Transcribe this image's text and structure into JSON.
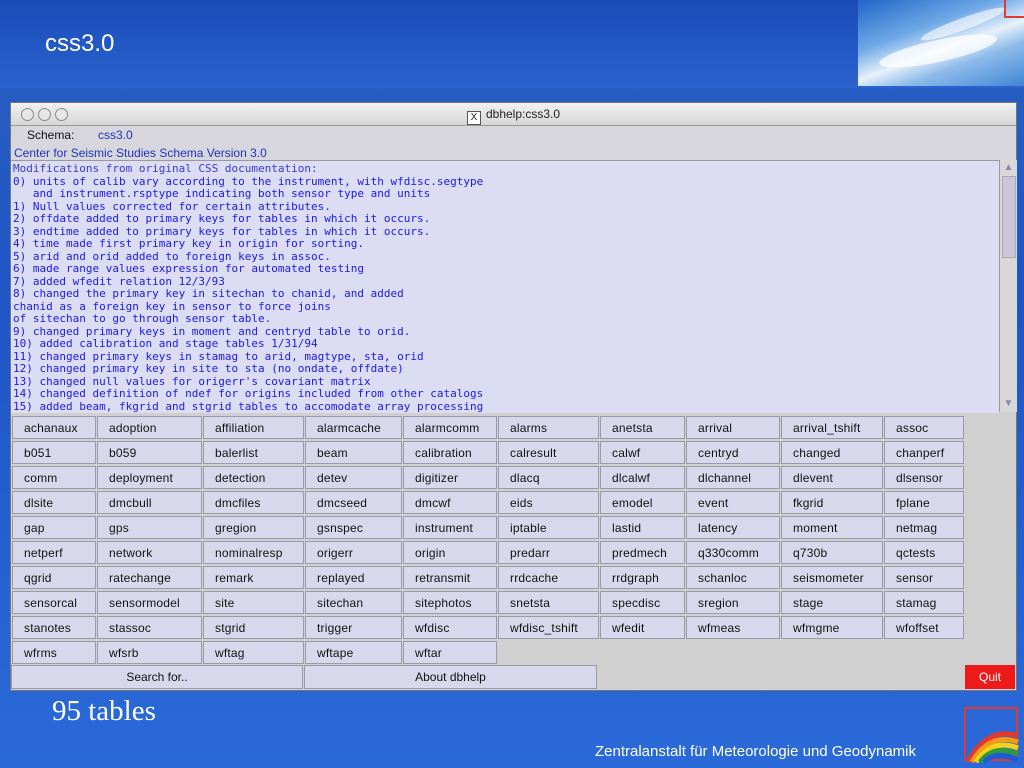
{
  "slide": {
    "title": "css3.0",
    "tables_count": "95 tables",
    "institution": "Zentralanstalt für Meteorologie und Geodynamik"
  },
  "window": {
    "title": "dbhelp:css3.0",
    "schema_label": "Schema:",
    "schema_value": "css3.0",
    "subtitle": "Center for Seismic Studies Schema Version 3.0",
    "text_lines": [
      "Modifications from original CSS documentation:",
      "0) units of calib vary according to the instrument, with wfdisc.segtype",
      "   and instrument.rsptype indicating both sensor type and units",
      "1) Null values corrected for certain attributes.",
      "2) offdate added to primary keys for tables in which it occurs.",
      "3) endtime added to primary keys for tables in which it occurs.",
      "4) time made first primary key in origin for sorting.",
      "5) arid and orid added to foreign keys in assoc.",
      "6) made range values expression for automated testing",
      "7) added wfedit relation 12/3/93",
      "8) changed the primary key in sitechan to chanid, and added",
      "chanid as a foreign key in sensor to force joins",
      "of sitechan to go through sensor table.",
      "9) changed primary keys in moment and centryd table to orid.",
      "10) added calibration and stage tables 1/31/94",
      "11) changed primary keys in stamag to arid, magtype, sta, orid",
      "12) changed primary key in site to sta (no ondate, offdate)",
      "13) changed null values for origerr's covariant matrix",
      "14) changed definition of ndef for origins included from other catalogs",
      "15) added beam, fkgrid and stgrid tables to accomodate array processing"
    ],
    "tables": [
      [
        "achanaux",
        "adoption",
        "affiliation",
        "alarmcache",
        "alarmcomm",
        "alarms",
        "anetsta",
        "arrival",
        "arrival_tshift",
        "assoc"
      ],
      [
        "b051",
        "b059",
        "balerlist",
        "beam",
        "calibration",
        "calresult",
        "calwf",
        "centryd",
        "changed",
        "chanperf"
      ],
      [
        "comm",
        "deployment",
        "detection",
        "detev",
        "digitizer",
        "dlacq",
        "dlcalwf",
        "dlchannel",
        "dlevent",
        "dlsensor"
      ],
      [
        "dlsite",
        "dmcbull",
        "dmcfiles",
        "dmcseed",
        "dmcwf",
        "eids",
        "emodel",
        "event",
        "fkgrid",
        "fplane"
      ],
      [
        "gap",
        "gps",
        "gregion",
        "gsnspec",
        "instrument",
        "iptable",
        "lastid",
        "latency",
        "moment",
        "netmag"
      ],
      [
        "netperf",
        "network",
        "nominalresp",
        "origerr",
        "origin",
        "predarr",
        "predmech",
        "q330comm",
        "q730b",
        "qctests"
      ],
      [
        "qgrid",
        "ratechange",
        "remark",
        "replayed",
        "retransmit",
        "rrdcache",
        "rrdgraph",
        "schanloc",
        "seismometer",
        "sensor"
      ],
      [
        "sensorcal",
        "sensormodel",
        "site",
        "sitechan",
        "sitephotos",
        "snetsta",
        "specdisc",
        "sregion",
        "stage",
        "stamag"
      ],
      [
        "stanotes",
        "stassoc",
        "stgrid",
        "trigger",
        "wfdisc",
        "wfdisc_tshift",
        "wfedit",
        "wfmeas",
        "wfmgme",
        "wfoffset"
      ],
      [
        "wfrms",
        "wfsrb",
        "wftag",
        "wftape",
        "wftar"
      ]
    ],
    "search_label": "Search for..",
    "about_label": "About dbhelp",
    "quit_label": "Quit",
    "colors": {
      "quit": "#ee1a1a",
      "text": "#1a1aee",
      "button_bg": "#d8d8ec"
    }
  }
}
